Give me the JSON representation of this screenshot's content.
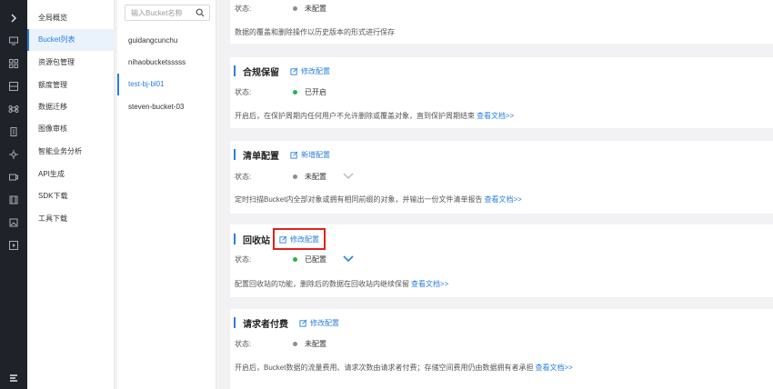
{
  "rail": {
    "icons": [
      "chevron-right-icon",
      "overview-icon",
      "grid-icon",
      "storage-icon",
      "command-icon",
      "building-icon",
      "network-icon",
      "monitor-icon",
      "server-icon",
      "image-icon",
      "play-icon"
    ],
    "bottom_icon": "menu-icon"
  },
  "menu": {
    "items": [
      "全局概览",
      "Bucket列表",
      "资源包管理",
      "额度管理",
      "数据迁移",
      "图像审核",
      "智能业务分析",
      "API生成",
      "SDK下载",
      "工具下载"
    ],
    "active_index": 1
  },
  "buckets": {
    "search_placeholder": "输入Bucket名称",
    "items": [
      "guidangcunchu",
      "nihaobucketsssss",
      "test-bj-bl01",
      "steven-bucket-03"
    ],
    "active_index": 2
  },
  "cards": {
    "versioning": {
      "status_label": "状态:",
      "status_value": "未配置",
      "status_color": "#8d8d8d",
      "description": "数据的覆盖和删除操作以历史版本的形式进行保存"
    },
    "compliance": {
      "title": "合规保留",
      "edit_label": "修改配置",
      "status_label": "状态:",
      "status_value": "已开启",
      "status_color": "#29b34a",
      "description": "开启后，在保护周期内任何用户不允许删除或覆盖对象，直到保护周期结束",
      "link": "查看文档>>"
    },
    "inventory": {
      "title": "清单配置",
      "edit_label": "新增配置",
      "status_label": "状态:",
      "status_value": "未配置",
      "status_color": "#8d8d8d",
      "description": "定时扫描Bucket内全部对象或拥有相同前缀的对象，并输出一份文件清单报告",
      "link": "查看文档>>"
    },
    "recycle": {
      "title": "回收站",
      "edit_label": "修改配置",
      "status_label": "状态:",
      "status_value": "已配置",
      "status_color": "#29b34a",
      "description": "配置回收站的功能，删除后的数据在回收站内继续保留",
      "link": "查看文档>>"
    },
    "requester": {
      "title": "请求者付费",
      "edit_label": "修改配置",
      "status_label": "状态:",
      "status_value": "未配置",
      "status_color": "#8d8d8d",
      "description": "开启后，Bucket数据的流量费用、请求次数由请求者付费；存储空间费用仍由数据拥有者承担",
      "link": "查看文档>>"
    }
  },
  "colors": {
    "accent": "#2a7fe0",
    "highlight_box": "#e3201b",
    "rail": "#1f2229"
  }
}
